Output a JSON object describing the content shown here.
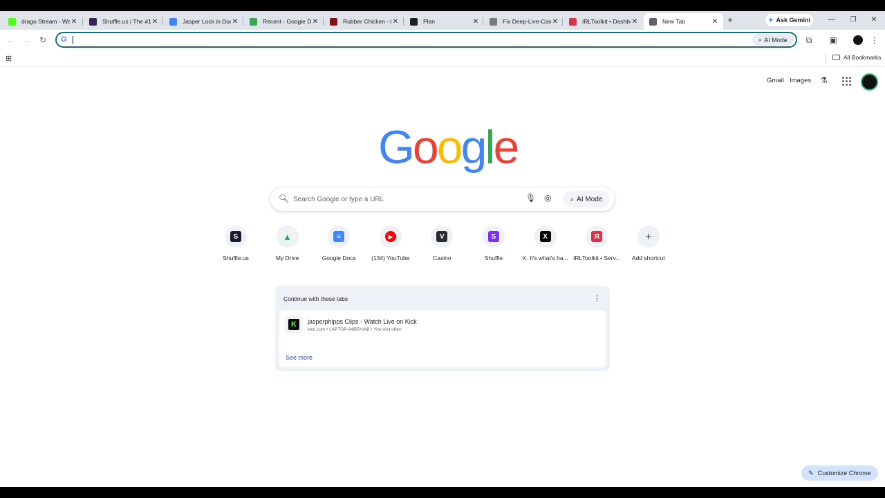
{
  "tabs": [
    {
      "title": "drago Stream - Wa",
      "favicon": "kick-icon",
      "color": "#53fc18"
    },
    {
      "title": "Shuffle.us | The #1",
      "favicon": "shuffle-icon",
      "color": "#3b1e5c"
    },
    {
      "title": "Jasper Lock in Doc",
      "favicon": "docs-icon",
      "color": "#4285f4"
    },
    {
      "title": "Recent - Google Dr",
      "favicon": "drive-icon",
      "color": "#34a853"
    },
    {
      "title": "Rubber Chicken - I",
      "favicon": "chicken-icon",
      "color": "#8b0f14"
    },
    {
      "title": "Plan",
      "favicon": "x-logo-icon",
      "color": "#1f1f1f"
    },
    {
      "title": "Fix Deep-Live-Cam",
      "favicon": "globe-icon",
      "color": "#7a7a7a"
    },
    {
      "title": "IRLToolkit • Dashbo",
      "favicon": "irltoolkit-icon",
      "color": "#d63447"
    },
    {
      "title": "New Tab",
      "favicon": "chrome-icon",
      "color": "#5f6368"
    }
  ],
  "gemini_button": "Ask Gemini",
  "omnibox": {
    "value": "",
    "ai_mode": "AI Mode"
  },
  "bookmarks": {
    "all": "All Bookmarks"
  },
  "header_links": {
    "gmail": "Gmail",
    "images": "Images"
  },
  "logo": {
    "letters": [
      {
        "char": "G",
        "color": "#4285f4"
      },
      {
        "char": "o",
        "color": "#ea4335"
      },
      {
        "char": "o",
        "color": "#fbbc05"
      },
      {
        "char": "g",
        "color": "#4285f4"
      },
      {
        "char": "l",
        "color": "#34a853"
      },
      {
        "char": "e",
        "color": "#ea4335"
      }
    ]
  },
  "search": {
    "placeholder": "Search Google or type a URL",
    "ai_mode": "AI Mode"
  },
  "shortcuts": [
    {
      "label": "Shuffle.us",
      "icon": "shuffle-us-icon",
      "color": "#1b1b2f",
      "glyph": "S"
    },
    {
      "label": "My Drive",
      "icon": "drive-icon",
      "color": "#34a853",
      "glyph": "▲"
    },
    {
      "label": "Google Docs",
      "icon": "docs-icon",
      "color": "#4285f4",
      "glyph": "≡"
    },
    {
      "label": "(134) YouTube",
      "icon": "youtube-icon",
      "color": "#ff0000",
      "glyph": "▶"
    },
    {
      "label": "Casino",
      "icon": "casino-icon",
      "color": "#2b2b2b",
      "glyph": "V"
    },
    {
      "label": "Shuffle",
      "icon": "shuffle-icon",
      "color": "#7b2ff7",
      "glyph": "S"
    },
    {
      "label": "X. It's what's ha...",
      "icon": "x-logo-icon",
      "color": "#000000",
      "glyph": "X"
    },
    {
      "label": "IRLToolkit • Serv...",
      "icon": "irltoolkit-icon",
      "color": "#d63447",
      "glyph": "Я"
    },
    {
      "label": "Add shortcut",
      "icon": "plus-icon",
      "color": "#eef1f6",
      "glyph": "+"
    }
  ],
  "continue": {
    "title": "Continue with these tabs",
    "item_title": "jasperphipps Clips - Watch Live on Kick",
    "item_sub": "kick.com • LAPTOP-94BEKIAB • You visit often",
    "see_more": "See more"
  },
  "customize": "Customize Chrome"
}
